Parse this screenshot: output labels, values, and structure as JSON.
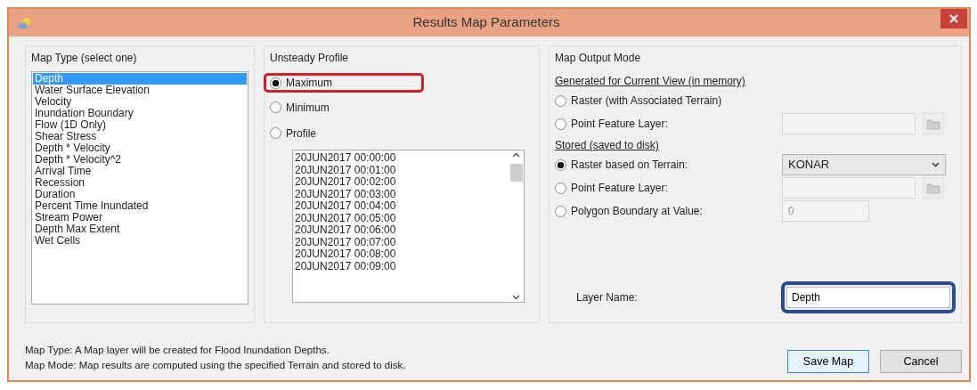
{
  "window": {
    "title": "Results Map Parameters"
  },
  "map_type": {
    "title": "Map Type (select one)",
    "items": [
      {
        "label": "Depth",
        "selected": true
      },
      {
        "label": "Water Surface Elevation",
        "selected": false
      },
      {
        "label": "Velocity",
        "selected": false
      },
      {
        "label": "Inundation Boundary",
        "selected": false
      },
      {
        "label": "Flow (1D Only)",
        "selected": false
      },
      {
        "label": "Shear Stress",
        "selected": false
      },
      {
        "label": "Depth * Velocity",
        "selected": false
      },
      {
        "label": "Depth * Velocity^2",
        "selected": false
      },
      {
        "label": "Arrival Time",
        "selected": false
      },
      {
        "label": "Recession",
        "selected": false
      },
      {
        "label": "Duration",
        "selected": false
      },
      {
        "label": "Percent Time Inundated",
        "selected": false
      },
      {
        "label": "Stream Power",
        "selected": false
      },
      {
        "label": "Depth Max Extent",
        "selected": false
      },
      {
        "label": "Wet Cells",
        "selected": false
      }
    ]
  },
  "unsteady_profile": {
    "title": "Unsteady Profile",
    "options": [
      {
        "label": "Maximum",
        "selected": true,
        "color": "#d0202a"
      },
      {
        "label": "Minimum",
        "selected": false
      },
      {
        "label": "Profile",
        "selected": false
      }
    ],
    "times": [
      "20JUN2017 00:00:00",
      "20JUN2017 00:01:00",
      "20JUN2017 00:02:00",
      "20JUN2017 00:03:00",
      "20JUN2017 00:04:00",
      "20JUN2017 00:05:00",
      "20JUN2017 00:06:00",
      "20JUN2017 00:07:00",
      "20JUN2017 00:08:00",
      "20JUN2017 00:09:00"
    ]
  },
  "map_output_mode": {
    "title": "Map Output Mode",
    "sections": [
      {
        "heading": "Generated for Current View (in memory)",
        "options": [
          {
            "kind": "plain",
            "label": "Raster (with Associated Terrain)",
            "selected": false
          },
          {
            "kind": "file",
            "label": "Point Feature Layer:",
            "selected": false,
            "disabled": true
          }
        ]
      },
      {
        "heading": "Stored (saved to disk)",
        "options": [
          {
            "kind": "select",
            "label": "Raster based on Terrain:",
            "selected": true,
            "value": "KONAR"
          },
          {
            "kind": "file",
            "label": "Point Feature Layer:",
            "selected": false,
            "disabled": true
          },
          {
            "kind": "value",
            "label": "Polygon Boundary at Value:",
            "selected": false,
            "value": "0",
            "disabled": true
          }
        ]
      }
    ],
    "layer_name": {
      "label": "Layer Name:",
      "value": "Depth",
      "color": "#2a4b8c"
    }
  },
  "footer": [
    "Map Type: A Map layer will be created for Flood Inundation Depths.",
    "Map Mode: Map results are computed using the specified Terrain and stored to disk."
  ],
  "buttons": [
    {
      "label": "Save Map",
      "kind": "default"
    },
    {
      "label": "Cancel",
      "kind": "normal"
    }
  ]
}
